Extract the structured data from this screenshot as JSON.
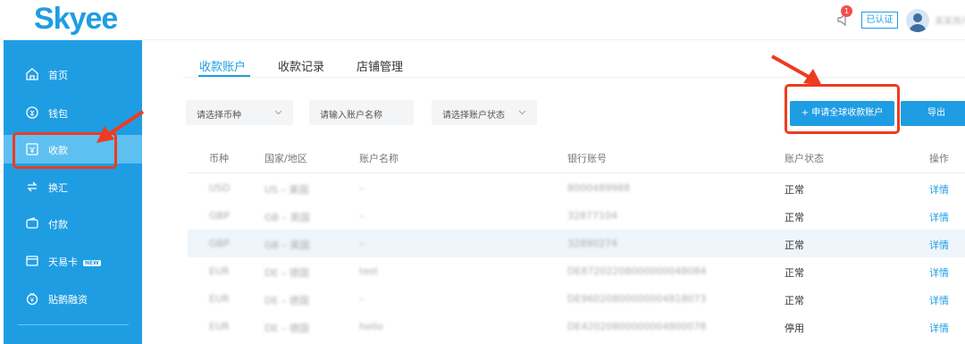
{
  "header": {
    "logo": "Skyee",
    "notification_count": "1",
    "verified_label": "已认证",
    "username": "某某用户"
  },
  "sidebar": {
    "items": [
      {
        "label": "首页",
        "icon": "home-icon"
      },
      {
        "label": "钱包",
        "icon": "wallet-icon"
      },
      {
        "label": "收款",
        "icon": "receive-icon",
        "active": true
      },
      {
        "label": "换汇",
        "icon": "exchange-icon"
      },
      {
        "label": "付款",
        "icon": "payment-icon"
      },
      {
        "label": "天易卡",
        "icon": "card-icon",
        "badge": "NEW"
      },
      {
        "label": "贴鹅融资",
        "icon": "finance-icon"
      }
    ]
  },
  "tabs": [
    {
      "label": "收款账户",
      "active": true
    },
    {
      "label": "收款记录"
    },
    {
      "label": "店铺管理"
    }
  ],
  "filters": {
    "currency_placeholder": "请选择币种",
    "name_placeholder": "请输入账户名称",
    "status_placeholder": "请选择账户状态"
  },
  "actions": {
    "apply_label": "+ 申请全球收款账户",
    "export_label": "导出"
  },
  "table": {
    "columns": [
      "币种",
      "国家/地区",
      "账户名称",
      "银行账号",
      "账户状态",
      "操作"
    ],
    "rows": [
      {
        "currency": "USD",
        "region": "US – 美国",
        "name": "–",
        "account": "8000489988",
        "status": "正常",
        "action": "详情"
      },
      {
        "currency": "GBP",
        "region": "GB – 英国",
        "name": "–",
        "account": "32877104",
        "status": "正常",
        "action": "详情"
      },
      {
        "currency": "GBP",
        "region": "GB – 英国",
        "name": "–",
        "account": "32890274",
        "status": "正常",
        "action": "详情"
      },
      {
        "currency": "EUR",
        "region": "DE – 德国",
        "name": "test",
        "account": "DE87202208000000048084",
        "status": "正常",
        "action": "详情"
      },
      {
        "currency": "EUR",
        "region": "DE – 德国",
        "name": "–",
        "account": "DE96020800000004818073",
        "status": "正常",
        "action": "详情"
      },
      {
        "currency": "EUR",
        "region": "DE – 德国",
        "name": "hello",
        "account": "DE42020800000004800078",
        "status": "停用",
        "action": "详情"
      }
    ]
  },
  "colors": {
    "brand": "#1f9de3",
    "annotation": "#ee3b1f"
  }
}
